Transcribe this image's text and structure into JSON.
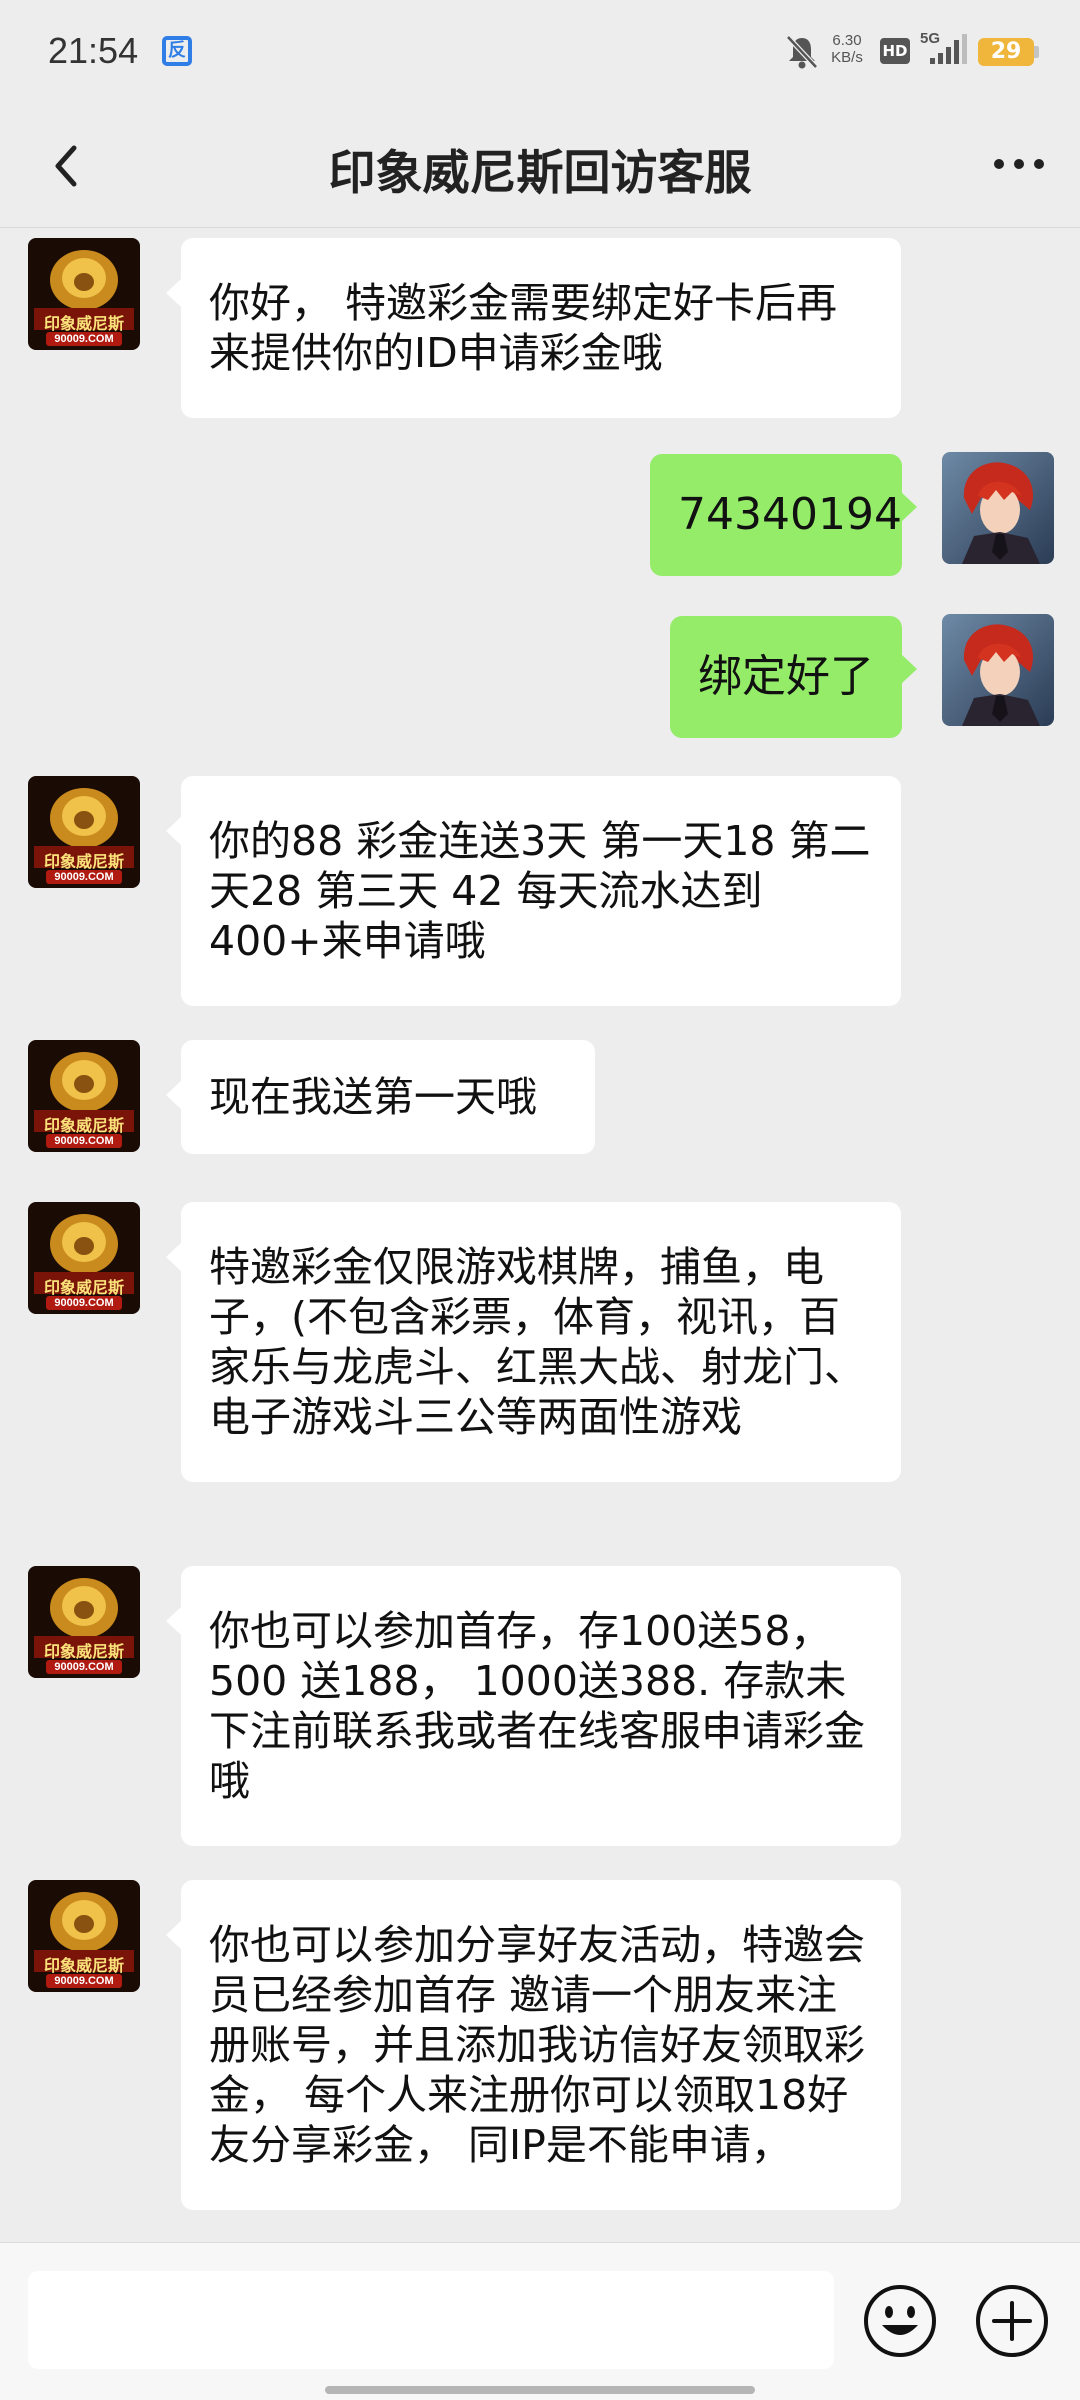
{
  "status_bar": {
    "time": "21:54",
    "app_icon_glyph": "反",
    "net_speed_value": "6.30",
    "net_speed_unit": "KB/s",
    "hd_label": "HD",
    "network_label": "5G",
    "battery_level": "29"
  },
  "nav": {
    "title": "印象威尼斯回访客服"
  },
  "messages": [
    {
      "side": "left",
      "text": "你好， 特邀彩金需要绑定好卡后再来提供你的ID申请彩金哦"
    },
    {
      "side": "right",
      "text": "74340194"
    },
    {
      "side": "right",
      "text": "绑定好了"
    },
    {
      "side": "left",
      "text": "你的88 彩金连送3天 第一天18 第二天28 第三天 42 每天流水达到400+来申请哦"
    },
    {
      "side": "left",
      "text": "现在我送第一天哦"
    },
    {
      "side": "left",
      "text": "特邀彩金仅限游戏棋牌，捕鱼，电子，(不包含彩票，体育，视讯，百家乐与龙虎斗、红黑大战、射龙门、电子游戏斗三公等两面性游戏"
    },
    {
      "side": "left",
      "text": "你也可以参加首存，存100送58，500 送188， 1000送388. 存款未下注前联系我或者在线客服申请彩金哦"
    },
    {
      "side": "left",
      "text": "你也可以参加分享好友活动，特邀会员已经参加首存 邀请一个朋友来注册账号，并且添加我访信好友领取彩金， 每个人来注册你可以领取18好友分享彩金， 同IP是不能申请，"
    }
  ],
  "avatars": {
    "agent_logo_text": "印象威尼斯",
    "agent_logo_url": "90009.COM"
  },
  "input": {
    "value": "",
    "placeholder": ""
  },
  "colors": {
    "background": "#ededed",
    "bubble_self": "#95ec69",
    "bubble_other": "#ffffff",
    "battery": "#f0b63c"
  },
  "icons": {
    "back": "chevron-left-icon",
    "more": "more-dots-icon",
    "emoji": "emoji-icon",
    "plus": "plus-circle-icon",
    "mute": "bell-off-icon"
  }
}
